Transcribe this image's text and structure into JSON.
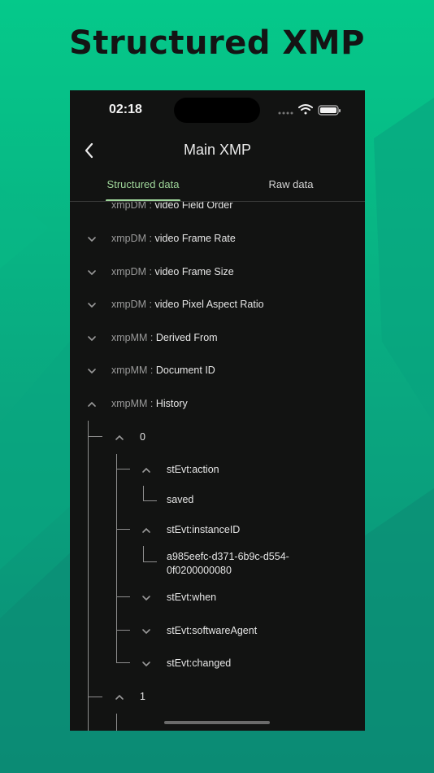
{
  "promo": {
    "title": "Structured XMP"
  },
  "status_bar": {
    "time": "02:18",
    "icons": [
      "signal-dots-icon",
      "wifi-icon",
      "battery-icon"
    ]
  },
  "nav": {
    "title": "Main XMP",
    "back_icon": "chevron-left-icon"
  },
  "tabs": [
    {
      "label": "Structured data",
      "selected": true
    },
    {
      "label": "Raw data",
      "selected": false
    }
  ],
  "tree": {
    "partial_top": {
      "ns": "xmpDM",
      "key": "video Field Order"
    },
    "items": [
      {
        "ns": "xmpDM",
        "sep": " : ",
        "key": "video Frame Rate",
        "expanded": false
      },
      {
        "ns": "xmpDM",
        "sep": " : ",
        "key": "video Frame Size",
        "expanded": false
      },
      {
        "ns": "xmpDM",
        "sep": " : ",
        "key": "video Pixel Aspect Ratio",
        "expanded": false
      },
      {
        "ns": "xmpMM",
        "sep": " : ",
        "key": "Derived From",
        "expanded": false
      },
      {
        "ns": "xmpMM",
        "sep": " : ",
        "key": "Document ID",
        "expanded": false
      },
      {
        "ns": "xmpMM",
        "sep": " : ",
        "key": "History",
        "expanded": true
      }
    ],
    "history": {
      "index0": "0",
      "action_key": "stEvt:action",
      "action_value": "saved",
      "instance_key": "stEvt:instanceID",
      "instance_value": "a985eefc-d371-6b9c-d554-0f0200000080",
      "instance_value_line1": "a985eefc-d371-6b9c-",
      "instance_value_line2": "d554-0f0200000080",
      "when_key": "stEvt:when",
      "software_key": "stEvt:softwareAgent",
      "changed_key": "stEvt:changed",
      "index1": "1"
    }
  },
  "colors": {
    "accent": "#9fd69a",
    "background": "#121312",
    "promo_bg": "#05c98a"
  }
}
